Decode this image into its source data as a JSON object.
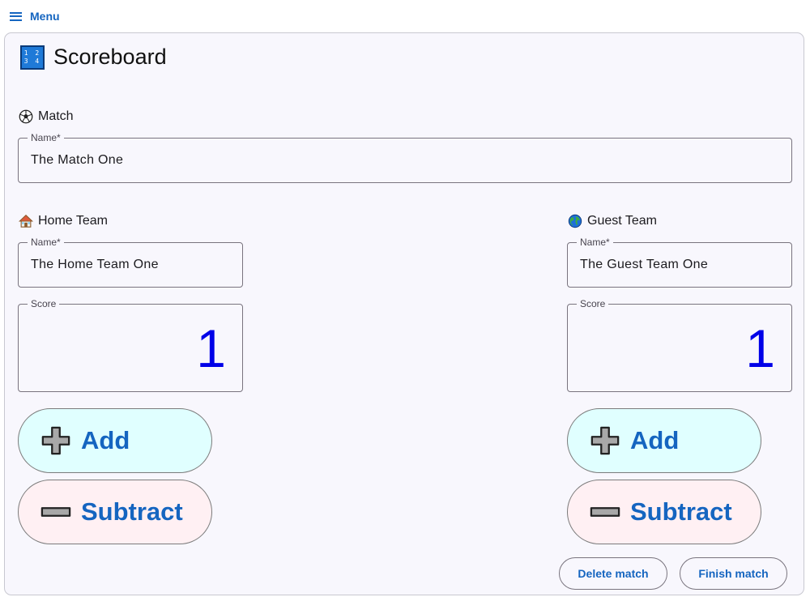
{
  "menu": {
    "label": "Menu"
  },
  "title": {
    "text": "Scoreboard",
    "icon_digits": [
      "1 2",
      "3 4"
    ]
  },
  "match": {
    "heading": "Match",
    "name_label": "Name*",
    "name_value": "The Match One"
  },
  "home": {
    "heading": "Home Team",
    "name_label": "Name*",
    "name_value": "The Home Team One",
    "score_label": "Score",
    "score_value": "1",
    "add_label": "Add",
    "subtract_label": "Subtract"
  },
  "guest": {
    "heading": "Guest Team",
    "name_label": "Name*",
    "name_value": "The Guest Team One",
    "score_label": "Score",
    "score_value": "1",
    "add_label": "Add",
    "subtract_label": "Subtract"
  },
  "actions": {
    "delete_label": "Delete match",
    "finish_label": "Finish match"
  },
  "colors": {
    "accent": "#1565c0",
    "score": "#0000e8",
    "add_bg": "#e0ffff",
    "subtract_bg": "#fff0f3",
    "card_bg": "#f8f7fd"
  },
  "icons": {
    "menu": "hamburger-icon",
    "title": "numbers-keycap-icon",
    "match": "soccer-ball-icon",
    "home": "house-icon",
    "guest": "globe-icon",
    "add": "plus-icon",
    "subtract": "minus-icon"
  }
}
